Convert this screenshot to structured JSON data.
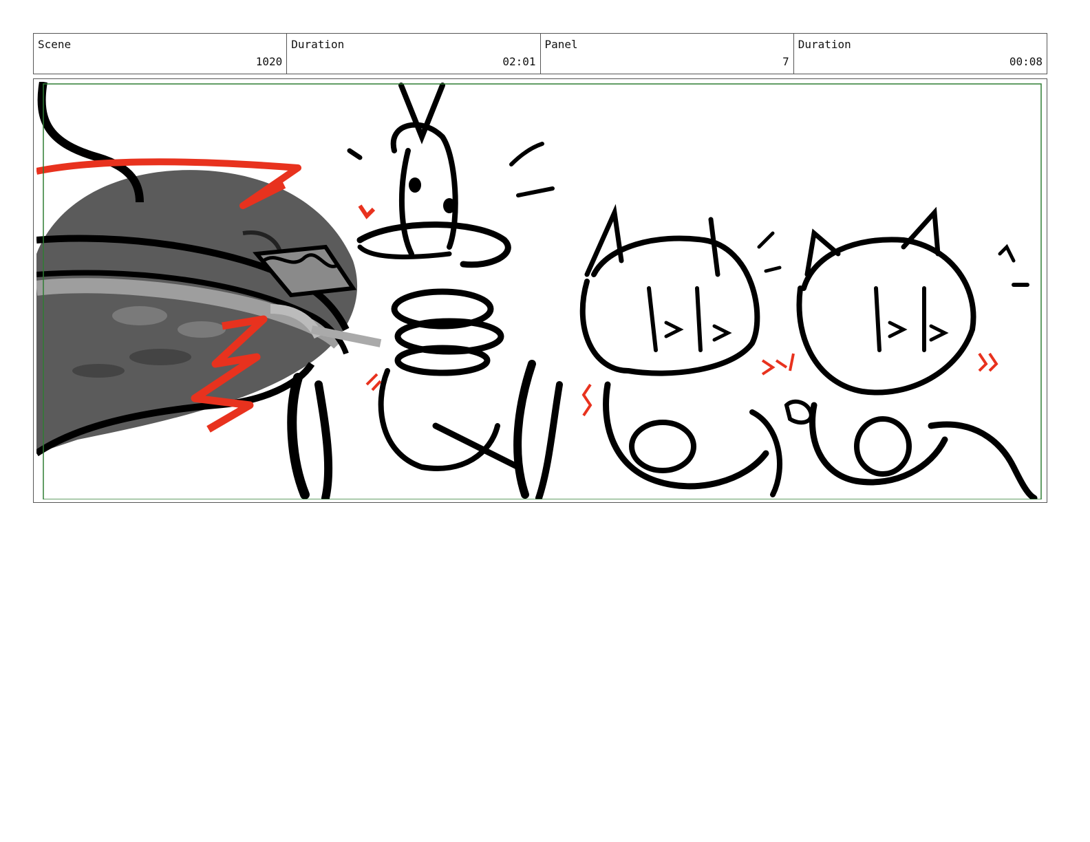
{
  "header": {
    "scene_label": "Scene",
    "scene_value": "1020",
    "scene_duration_label": "Duration",
    "scene_duration_value": "02:01",
    "panel_label": "Panel",
    "panel_value": "7",
    "panel_duration_label": "Duration",
    "panel_duration_value": "00:08"
  },
  "colors": {
    "accent_red": "#e8321e",
    "safe_frame_green": "#2e7d32",
    "ink": "#000000"
  }
}
